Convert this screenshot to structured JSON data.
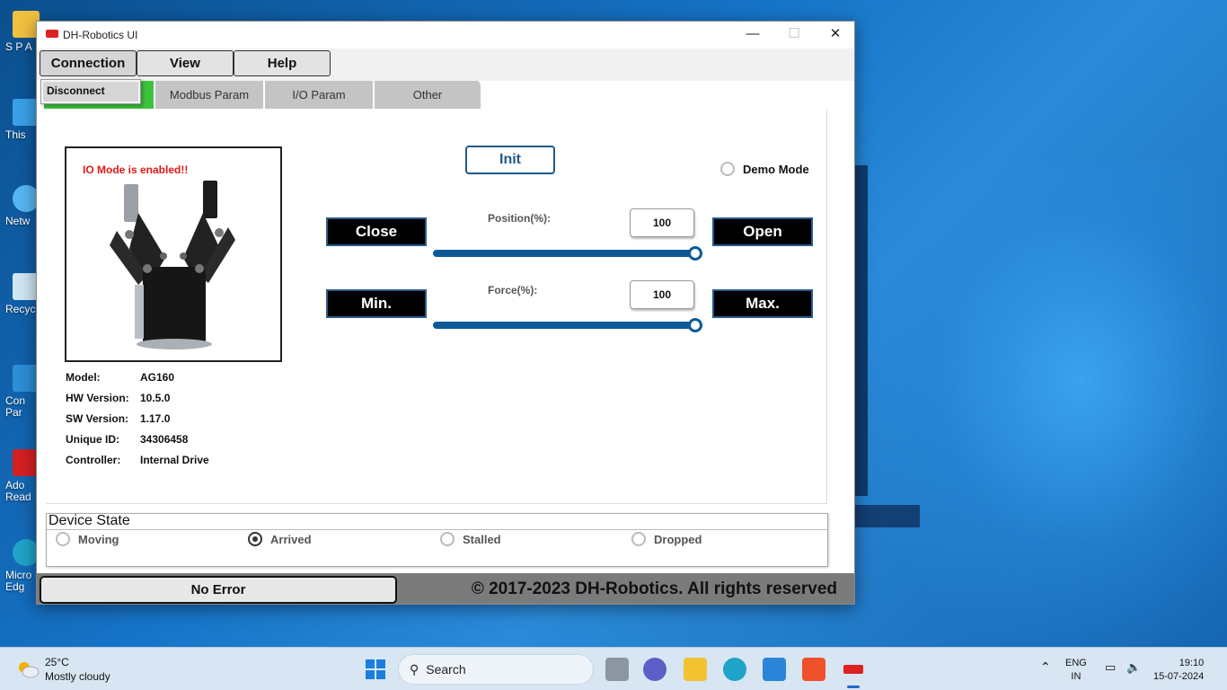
{
  "desktop": {
    "icons": [
      {
        "label": "S P A",
        "icon": "folder-icon"
      },
      {
        "label": "This",
        "icon": "this-pc-icon"
      },
      {
        "label": "Netw",
        "icon": "network-icon"
      },
      {
        "label": "Recyc",
        "icon": "recycle-bin-icon"
      },
      {
        "label": "Con\nPar",
        "icon": "control-panel-icon"
      },
      {
        "label": "Ado\nRead",
        "icon": "adobe-reader-icon"
      },
      {
        "label": "Micro\nEdg",
        "icon": "edge-icon"
      }
    ]
  },
  "window": {
    "title": "DH-Robotics UI",
    "controls": {
      "minimize": "—",
      "maximize": "☐",
      "close": "✕"
    }
  },
  "menu": {
    "connection": "Connection",
    "view": "View",
    "help": "Help",
    "dropdown_item": "Disconnect"
  },
  "tabs": [
    {
      "label": ""
    },
    {
      "label": "Modbus Param"
    },
    {
      "label": "I/O Param"
    },
    {
      "label": "Other"
    }
  ],
  "device_panel": {
    "io_message": "IO Mode is enabled!!",
    "image_icon": "gripper-image-icon",
    "info": [
      {
        "key": "Model:",
        "value": "AG160"
      },
      {
        "key": "HW Version:",
        "value": "10.5.0"
      },
      {
        "key": "SW Version:",
        "value": "1.17.0"
      },
      {
        "key": "Unique ID:",
        "value": "34306458"
      },
      {
        "key": "Controller:",
        "value": "Internal Drive"
      }
    ]
  },
  "controls": {
    "init_label": "Init",
    "demo_mode_label": "Demo Mode",
    "demo_mode_checked": false,
    "close_label": "Close",
    "open_label": "Open",
    "min_label": "Min.",
    "max_label": "Max.",
    "position_label": "Position(%):",
    "position_value": "100",
    "force_label": "Force(%):",
    "force_value": "100",
    "position_fraction": 1.0,
    "force_fraction": 1.0,
    "slider_color": "#0c5a98"
  },
  "device_state": {
    "title": "Device State",
    "options": [
      {
        "label": "Moving",
        "selected": false
      },
      {
        "label": "Arrived",
        "selected": true
      },
      {
        "label": "Stalled",
        "selected": false
      },
      {
        "label": "Dropped",
        "selected": false
      }
    ]
  },
  "statusbar": {
    "error_text": "No Error",
    "copyright": "© 2017-2023 DH-Robotics. All rights reserved"
  },
  "taskbar": {
    "temperature": "25°C",
    "weather": "Mostly cloudy",
    "search_label": "Search",
    "lang": "ENG",
    "region": "IN",
    "time": "19:10",
    "date": "15-07-2024",
    "apps": [
      "start-icon",
      "file-explorer-icon",
      "teams-icon",
      "folder-icon",
      "edge-icon",
      "store-icon",
      "brave-icon",
      "dh-robotics-icon"
    ]
  }
}
